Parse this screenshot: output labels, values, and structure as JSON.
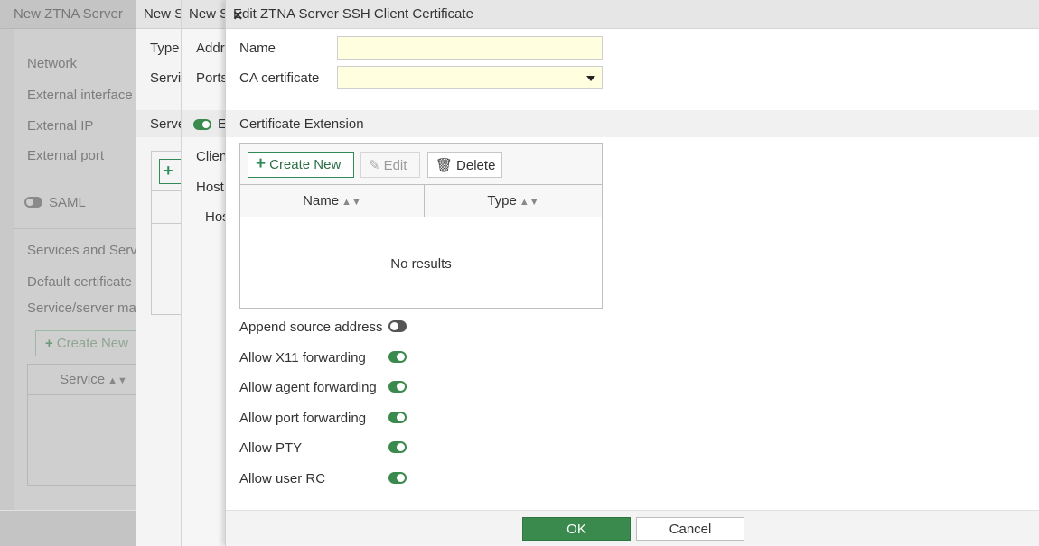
{
  "background_panel": {
    "title": "New ZTNA Server",
    "labels": [
      "Network",
      "External interface",
      "External IP",
      "External port"
    ],
    "saml_label": "SAML",
    "services_label": "Services and Serve",
    "default_certificate_label": "Default certificate",
    "service_mapping_label": "Service/server map",
    "create_new_label": "Create New",
    "service_column": "Service"
  },
  "middle_panel_1": {
    "title": "New S",
    "labels": [
      "Type",
      "Servi"
    ],
    "server_label": "Serve",
    "create_icon": "+"
  },
  "middle_panel_2": {
    "title": "New S",
    "labels": [
      "Addr",
      "Ports"
    ],
    "enable_label": "E",
    "client_label": "Clien",
    "host_label": "Host",
    "host_sub_label": "Hos"
  },
  "dialog": {
    "title": "Edit ZTNA Server SSH Client Certificate",
    "close_icon": "×",
    "fields": {
      "name_label": "Name",
      "name_value": "",
      "ca_label": "CA certificate",
      "ca_value": ""
    },
    "section_title": "Certificate Extension",
    "table": {
      "create_label": "Create New",
      "edit_label": "Edit",
      "delete_label": "Delete",
      "columns": [
        "Name",
        "Type"
      ],
      "empty_text": "No results"
    },
    "toggles": [
      {
        "label": "Append source address",
        "on": false
      },
      {
        "label": "Allow X11 forwarding",
        "on": true
      },
      {
        "label": "Allow agent forwarding",
        "on": true
      },
      {
        "label": "Allow port forwarding",
        "on": true
      },
      {
        "label": "Allow PTY",
        "on": true
      },
      {
        "label": "Allow user RC",
        "on": true
      }
    ],
    "ok_label": "OK",
    "cancel_label": "Cancel"
  },
  "colors": {
    "accent_green": "#3a8a4e",
    "input_bg": "#ffffe0"
  }
}
